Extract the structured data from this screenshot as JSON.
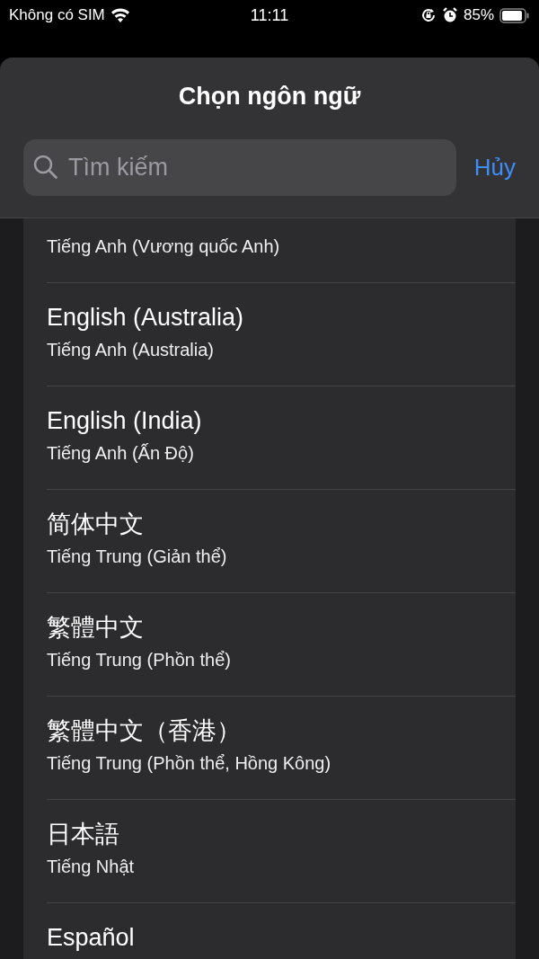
{
  "status_bar": {
    "carrier": "Không có SIM",
    "time": "11:11",
    "battery": "85%"
  },
  "sheet": {
    "title": "Chọn ngôn ngữ",
    "search": {
      "placeholder": "Tìm kiếm"
    },
    "cancel": "Hủy"
  },
  "languages": [
    {
      "subtitle": "Tiếng Anh (Vương quốc Anh)"
    },
    {
      "name": "English (Australia)",
      "subtitle": "Tiếng Anh (Australia)"
    },
    {
      "name": "English (India)",
      "subtitle": "Tiếng Anh (Ấn Độ)"
    },
    {
      "name": "简体中文",
      "subtitle": "Tiếng Trung (Giản thể)"
    },
    {
      "name": "繁體中文",
      "subtitle": "Tiếng Trung (Phồn thể)"
    },
    {
      "name": "繁體中文（香港）",
      "subtitle": "Tiếng Trung (Phồn thể, Hồng Kông)"
    },
    {
      "name": "日本語",
      "subtitle": "Tiếng Nhật"
    },
    {
      "name": "Español"
    }
  ]
}
